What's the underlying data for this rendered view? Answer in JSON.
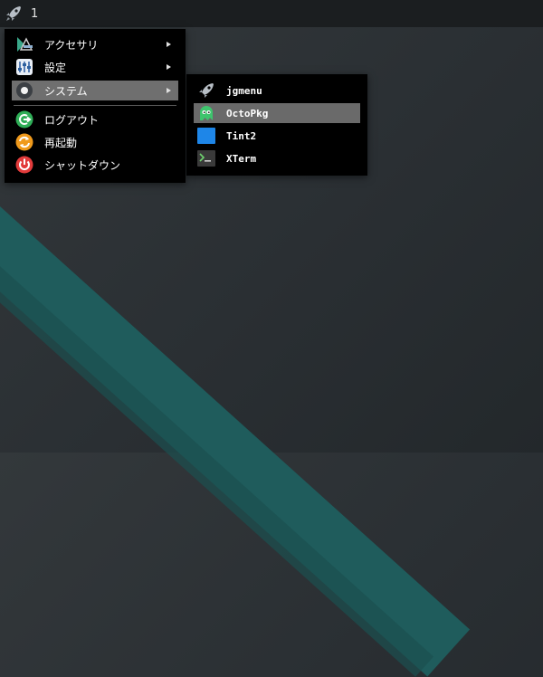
{
  "panel": {
    "workspace": "1",
    "launcher_icon": "rocket-icon"
  },
  "menu": {
    "items": [
      {
        "label": "アクセサリ",
        "icon": "accessories-icon"
      },
      {
        "label": "設定",
        "icon": "settings-icon"
      },
      {
        "label": "システム",
        "icon": "system-icon"
      },
      {
        "label": "ログアウト",
        "icon": "logout-icon"
      },
      {
        "label": "再起動",
        "icon": "restart-icon"
      },
      {
        "label": "シャットダウン",
        "icon": "shutdown-icon"
      }
    ]
  },
  "submenu": {
    "items": [
      {
        "label": "jgmenu",
        "icon": "rocket-icon"
      },
      {
        "label": "OctoPkg",
        "icon": "octopkg-icon"
      },
      {
        "label": "Tint2",
        "icon": "tint2-icon"
      },
      {
        "label": "XTerm",
        "icon": "terminal-icon"
      }
    ]
  },
  "colors": {
    "panel": "#1b1e20",
    "menu": "#000000",
    "highlight": "#6f6f6f",
    "stripe": "#1f5c5c"
  }
}
